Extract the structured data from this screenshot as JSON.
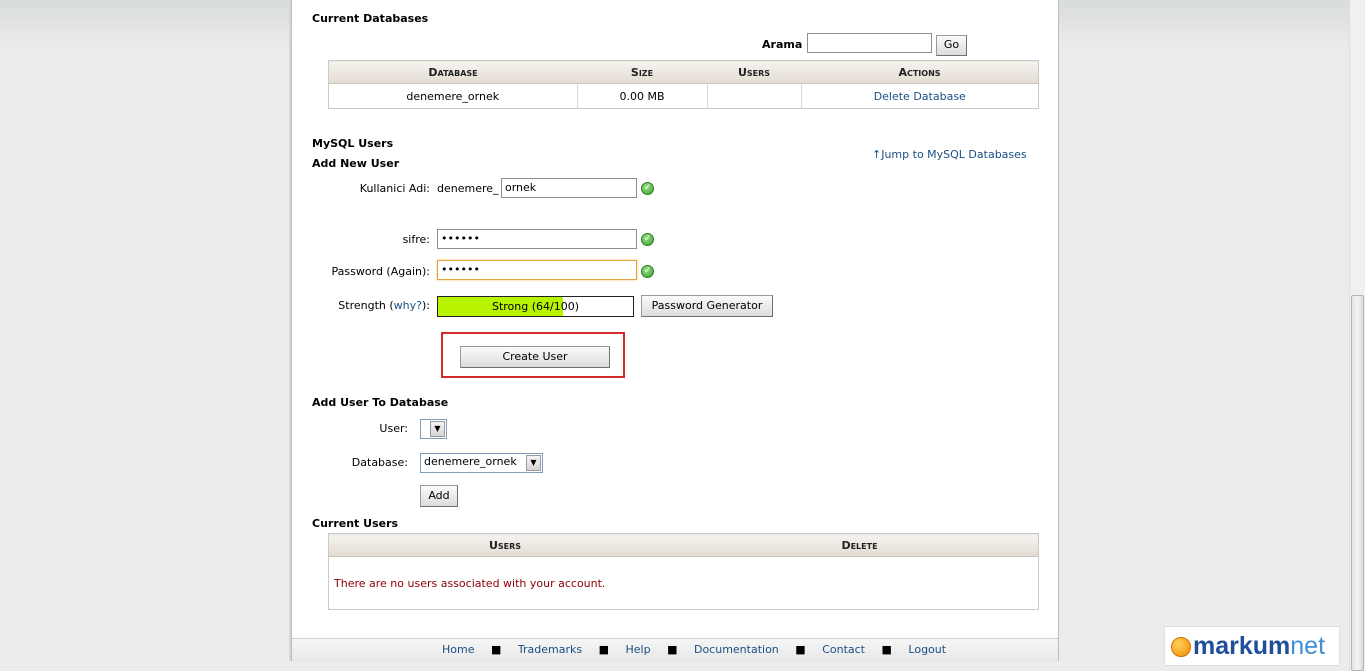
{
  "current_databases": {
    "title": "Current Databases",
    "search_label": "Arama",
    "search_value": "",
    "go_label": "Go",
    "columns": [
      "Database",
      "Size",
      "Users",
      "Actions"
    ],
    "rows": [
      {
        "database": "denemere_ornek",
        "size": "0.00 MB",
        "users": "",
        "action": "Delete Database"
      }
    ]
  },
  "mysql_users": {
    "title": "MySQL Users",
    "jump_link": "Jump to MySQL Databases",
    "add_new_user": {
      "title": "Add New User",
      "username_label": "Kullanici Adi:",
      "username_prefix": "denemere_",
      "username_value": "ornek",
      "password_label": "sifre:",
      "password_value": "••••••",
      "password_again_label": "Password (Again):",
      "password_again_value": "••••••",
      "strength_label_prefix": "Strength (",
      "strength_link": "why?",
      "strength_label_suffix": "):",
      "strength_text": "Strong (64/100)",
      "strength_value": 0.64,
      "generator_label": "Password Generator",
      "create_user_label": "Create User"
    }
  },
  "add_user_to_db": {
    "title": "Add User To Database",
    "user_label": "User:",
    "user_value": "",
    "database_label": "Database:",
    "database_value": "denemere_ornek",
    "add_label": "Add"
  },
  "current_users": {
    "title": "Current Users",
    "columns": [
      "Users",
      "Delete"
    ],
    "empty_message": "There are no users associated with your account."
  },
  "footer": {
    "links": [
      "Home",
      "Trademarks",
      "Help",
      "Documentation",
      "Contact",
      "Logout"
    ]
  },
  "watermark": {
    "brand_a": "markum",
    "brand_b": "net"
  },
  "colors": {
    "strength_fill": "#b8f400",
    "highlight_box": "#d42a2a",
    "link": "#1a4f84",
    "error_text": "#8b0000"
  }
}
